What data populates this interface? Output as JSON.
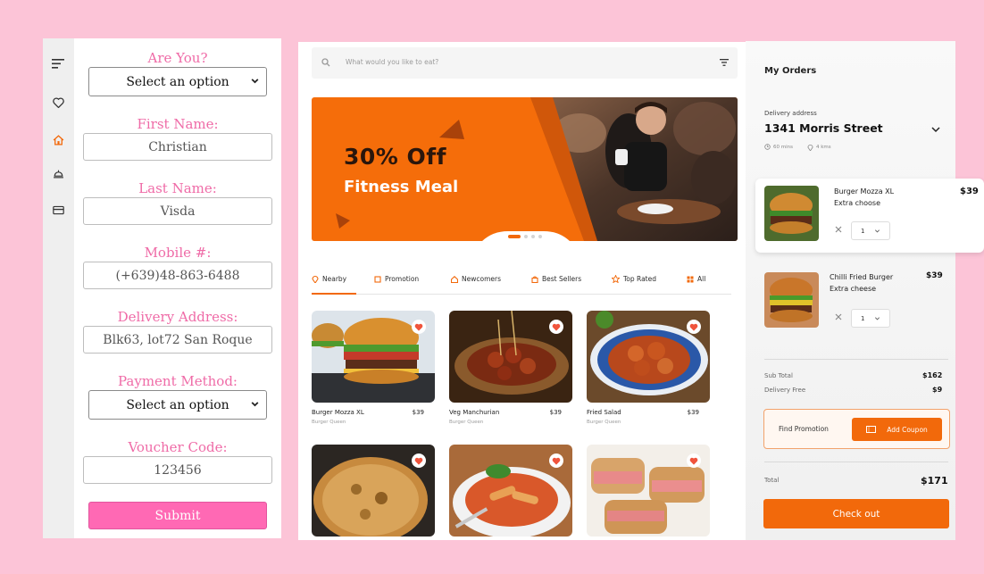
{
  "colors": {
    "page_bg": "#fcc4d7",
    "form_label": "#ef6ba7",
    "submit": "#ff69b4",
    "accent": "#f2690b"
  },
  "rail": {
    "icons": [
      "menu-icon",
      "heart-icon",
      "home-icon",
      "dish-icon",
      "card-icon"
    ]
  },
  "form": {
    "are_you_label": "Are You?",
    "are_you_value": "Select an option",
    "first_name_label": "First Name:",
    "first_name_value": "Christian",
    "last_name_label": "Last Name:",
    "last_name_value": "Visda",
    "mobile_label": "Mobile #:",
    "mobile_value": "(+639)48-863-6488",
    "address_label": "Delivery Address:",
    "address_value": "Blk63, lot72 San Roque",
    "payment_label": "Payment Method:",
    "payment_value": "Select an option",
    "voucher_label": "Voucher Code:",
    "voucher_value": "123456",
    "submit_label": "Submit"
  },
  "main": {
    "search_placeholder": "What would you like to eat?",
    "banner_title": "30% Off",
    "banner_subtitle": "Fitness Meal",
    "tabs": [
      "Nearby",
      "Promotion",
      "Newcomers",
      "Best Sellers",
      "Top Rated",
      "All"
    ],
    "foods": [
      {
        "name": "Burger Mozza XL",
        "price": "$39",
        "shop": "Burger Queen"
      },
      {
        "name": "Veg Manchurian",
        "price": "$39",
        "shop": "Burger Queen"
      },
      {
        "name": "Fried Salad",
        "price": "$39",
        "shop": "Burger Queen"
      }
    ]
  },
  "orders": {
    "title": "My Orders",
    "delivery_label": "Delivery address",
    "address": "1341  Morris Street",
    "time": "60 mins",
    "distance": "4 kms",
    "items": [
      {
        "name": "Burger Mozza XL",
        "variant": "Extra choose",
        "price": "$39",
        "qty": "1"
      },
      {
        "name": "Chilli Fried Burger",
        "variant": "Extra cheese",
        "price": "$39",
        "qty": "1"
      }
    ],
    "subtotal_label": "Sub Total",
    "subtotal": "$162",
    "delivery_fee_label": "Delivery Free",
    "delivery_fee": "$9",
    "promo_label": "Find Promotion",
    "coupon_label": "Add Coupon",
    "total_label": "Total",
    "total": "$171",
    "checkout_label": "Check out"
  }
}
